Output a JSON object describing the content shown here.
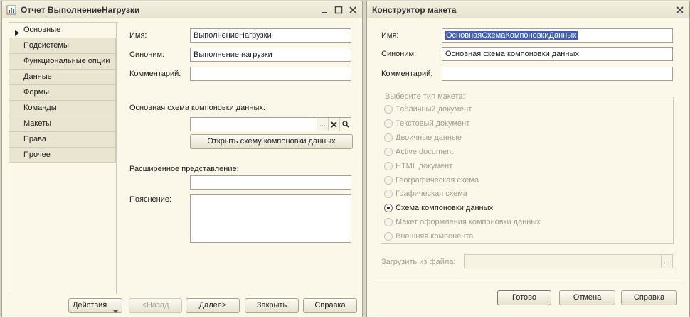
{
  "window1": {
    "title": "Отчет ВыполнениеНагрузки",
    "nav": [
      "Основные",
      "Подсистемы",
      "Функциональные опции",
      "Данные",
      "Формы",
      "Команды",
      "Макеты",
      "Права",
      "Прочее"
    ],
    "name_label": "Имя:",
    "name_value": "ВыполнениеНагрузки",
    "synonym_label": "Синоним:",
    "synonym_value": "Выполнение нагрузки",
    "comment_label": "Комментарий:",
    "comment_value": "",
    "schema_label": "Основная схема компоновки данных:",
    "schema_value": "",
    "schema_ellipsis": "...",
    "open_schema_button": "Открыть схему компоновки данных",
    "extended_label": "Расширенное представление:",
    "extended_value": "",
    "explanation_label": "Пояснение:",
    "explanation_value": "",
    "actions_button": "Действия",
    "back_button": "<Назад",
    "next_button": "Далее>",
    "close_button": "Закрыть",
    "help_button": "Справка"
  },
  "window2": {
    "title": "Конструктор макета",
    "name_label": "Имя:",
    "name_value": "ОсновнаяСхемаКомпоновкиДанных",
    "synonym_label": "Синоним:",
    "synonym_value": "Основная схема компоновки данных",
    "comment_label": "Комментарий:",
    "comment_value": "",
    "type_group_label": "Выберите тип макета:",
    "types": [
      {
        "label": "Табличный документ",
        "selected": false,
        "enabled": false
      },
      {
        "label": "Текстовый документ",
        "selected": false,
        "enabled": false
      },
      {
        "label": "Двоичные данные",
        "selected": false,
        "enabled": false
      },
      {
        "label": "Active document",
        "selected": false,
        "enabled": false
      },
      {
        "label": "HTML документ",
        "selected": false,
        "enabled": false
      },
      {
        "label": "Географическая схема",
        "selected": false,
        "enabled": false
      },
      {
        "label": "Графическая схема",
        "selected": false,
        "enabled": false
      },
      {
        "label": "Схема компоновки данных",
        "selected": true,
        "enabled": true
      },
      {
        "label": "Макет оформления компоновки данных",
        "selected": false,
        "enabled": false
      },
      {
        "label": "Внешняя компонента",
        "selected": false,
        "enabled": false
      }
    ],
    "load_label": "Загрузить из файла:",
    "load_value": "",
    "load_ellipsis": "...",
    "ok_button": "Готово",
    "cancel_button": "Отмена",
    "help_button": "Справка"
  }
}
